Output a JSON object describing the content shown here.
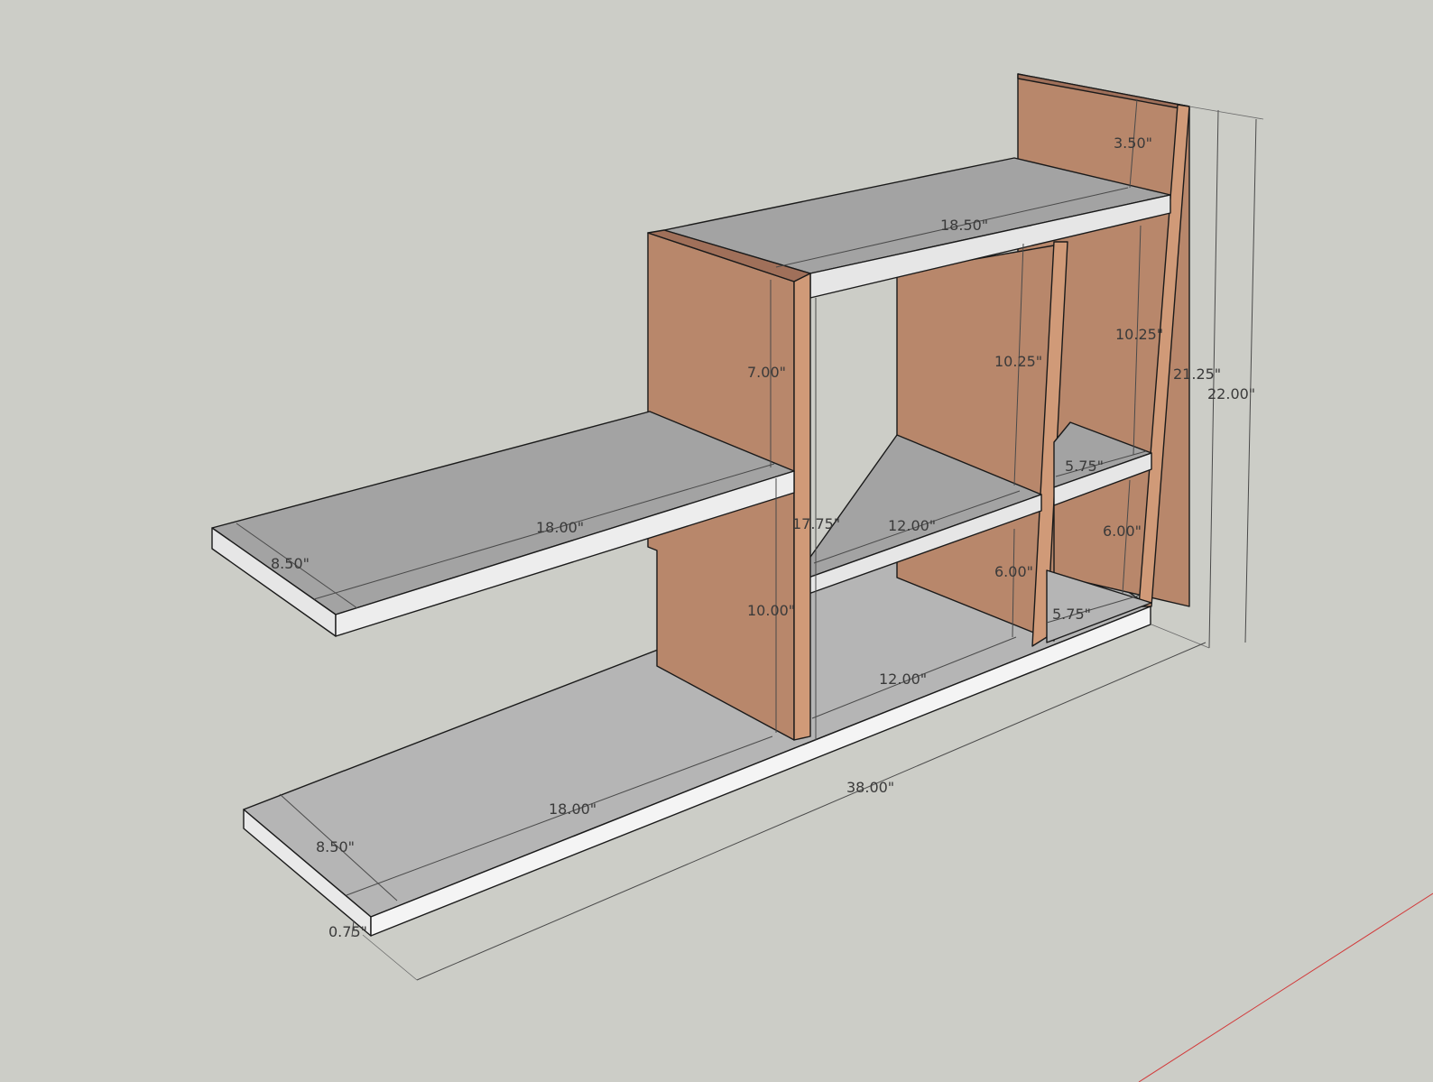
{
  "colors": {
    "background": "#cccdc7",
    "shelf_top": "#a3a3a3",
    "shelf_top_lower": "#b5b5b5",
    "shelf_front": "#e6e6e6",
    "shelf_front_bottom": "#f4f4f4",
    "side_panel": "#b8876b",
    "side_edge": "#d09a78",
    "side_top_edge": "#a0705a",
    "axis_red": "#d23a3a"
  },
  "dimensions": {
    "back_top_height": "3.50\"",
    "top_shelf_length": "18.50\"",
    "left_panel_upper": "7.00\"",
    "middle_upper_height": "10.25\"",
    "right_upper_height": "10.25\"",
    "overall_inner_height": "21.25\"",
    "overall_height": "22.00\"",
    "small_shelf_depth_mid": "5.75\"",
    "small_shelf_depth_low": "5.75\"",
    "left_shelf_length": "18.00\"",
    "left_shelf_depth": "8.50\"",
    "divider_height": "17.75\"",
    "mid_shelf_length": "12.00\"",
    "right_lower_height": "6.00\"",
    "middle_lower_height": "6.00\"",
    "left_panel_lower": "10.00\"",
    "bottom_inner_length": "12.00\"",
    "overall_length": "38.00\"",
    "bottom_shelf_length": "18.00\"",
    "bottom_shelf_depth": "8.50\"",
    "board_thickness": "0.75\""
  }
}
